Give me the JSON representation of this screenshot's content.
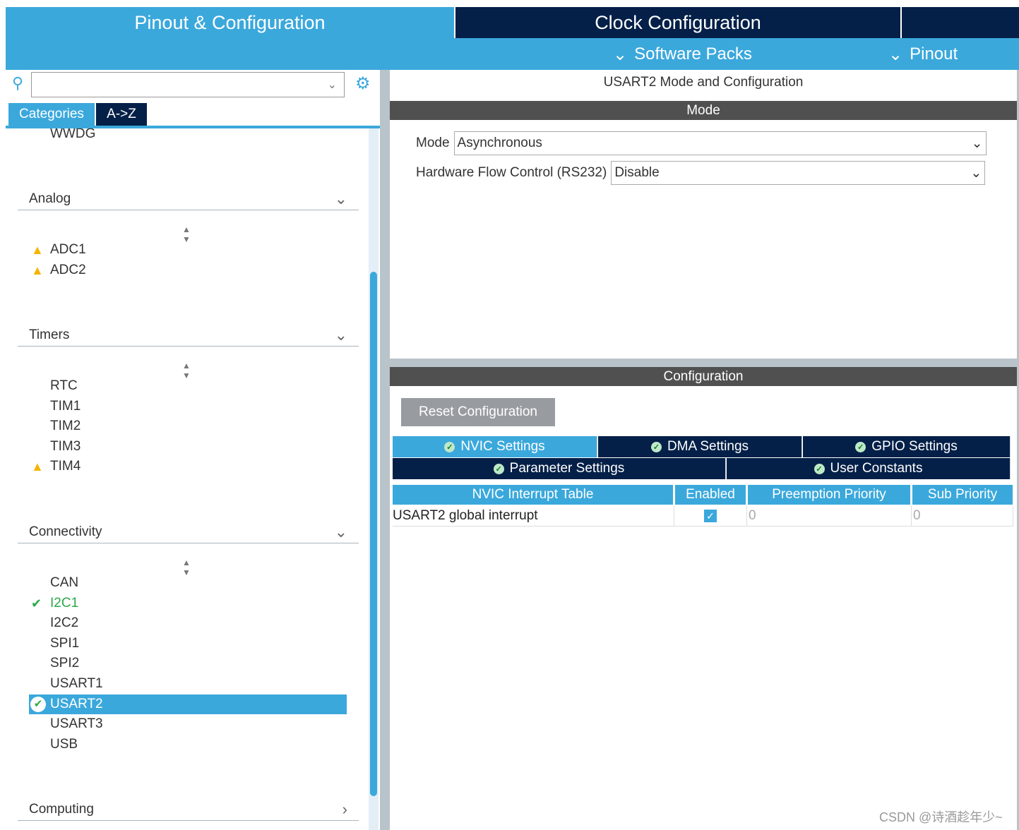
{
  "header": {
    "tabs": [
      {
        "label": "Pinout & Configuration"
      },
      {
        "label": "Clock Configuration"
      }
    ],
    "menus": [
      {
        "label": "Software Packs"
      },
      {
        "label": "Pinout"
      }
    ]
  },
  "sidebar": {
    "search": {
      "value": "",
      "placeholder": ""
    },
    "tabs": [
      {
        "label": "Categories"
      },
      {
        "label": "A->Z"
      }
    ],
    "top_item": "WWDG",
    "categories": [
      {
        "label": "Analog",
        "items": [
          {
            "label": "ADC1",
            "status": "warning"
          },
          {
            "label": "ADC2",
            "status": "warning"
          }
        ]
      },
      {
        "label": "Timers",
        "items": [
          {
            "label": "RTC"
          },
          {
            "label": "TIM1"
          },
          {
            "label": "TIM2"
          },
          {
            "label": "TIM3"
          },
          {
            "label": "TIM4",
            "status": "warning"
          }
        ]
      },
      {
        "label": "Connectivity",
        "items": [
          {
            "label": "CAN"
          },
          {
            "label": "I2C1",
            "status": "ok"
          },
          {
            "label": "I2C2"
          },
          {
            "label": "SPI1"
          },
          {
            "label": "SPI2"
          },
          {
            "label": "USART1"
          },
          {
            "label": "USART2",
            "status": "selected"
          },
          {
            "label": "USART3"
          },
          {
            "label": "USB"
          }
        ]
      },
      {
        "label": "Computing"
      }
    ]
  },
  "main": {
    "title": "USART2 Mode and Configuration",
    "mode": {
      "header": "Mode",
      "fields": [
        {
          "label": "Mode",
          "value": "Asynchronous"
        },
        {
          "label": "Hardware Flow Control (RS232)",
          "value": "Disable"
        }
      ]
    },
    "config": {
      "header": "Configuration",
      "reset_label": "Reset Configuration",
      "tabs": [
        {
          "label": "NVIC Settings",
          "active": true
        },
        {
          "label": "DMA Settings"
        },
        {
          "label": "GPIO Settings"
        },
        {
          "label": "Parameter Settings"
        },
        {
          "label": "User Constants"
        }
      ],
      "table": {
        "columns": [
          "NVIC Interrupt Table",
          "Enabled",
          "Preemption Priority",
          "Sub Priority"
        ],
        "rows": [
          {
            "name": "USART2 global interrupt",
            "enabled": true,
            "preemption": "0",
            "sub": "0"
          }
        ]
      }
    }
  },
  "watermark": "CSDN @诗酒趁年少~",
  "colors": {
    "accent": "#3ba8dc",
    "navy": "#042048",
    "bar": "#505050",
    "warning": "#f5b400",
    "ok": "#2ca84a"
  }
}
